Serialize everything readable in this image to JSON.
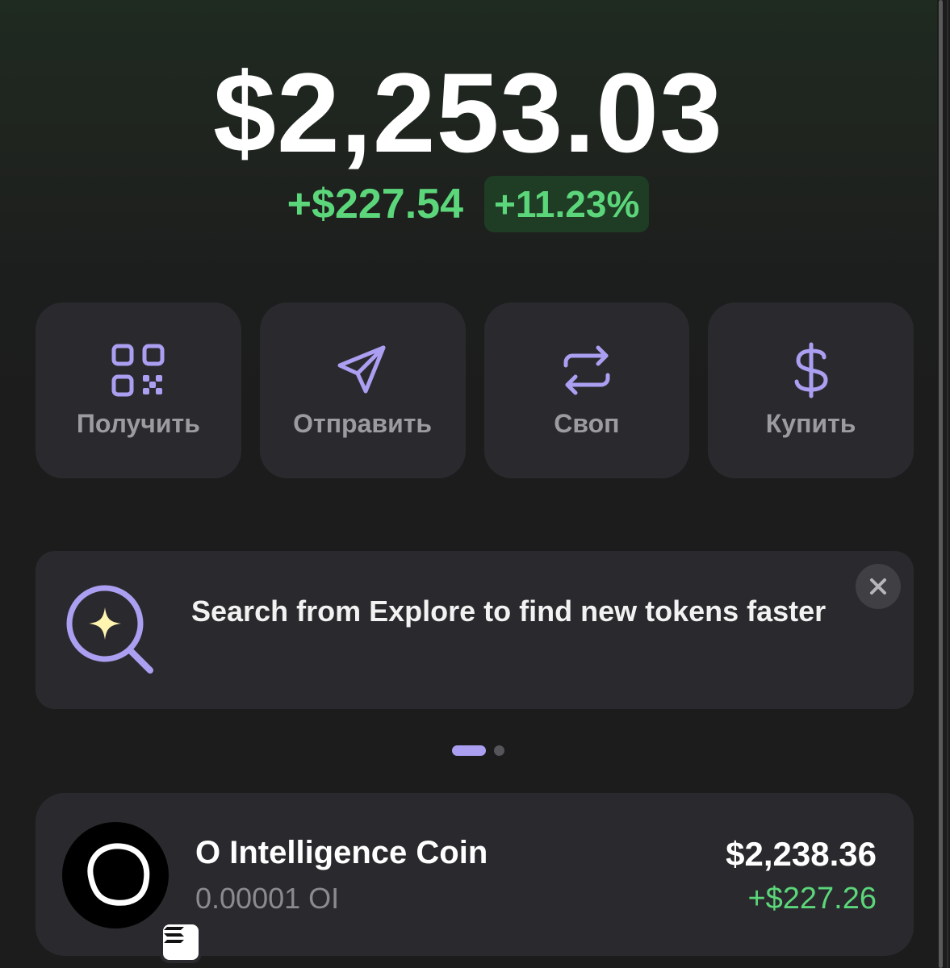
{
  "balance": {
    "total": "$2,253.03",
    "change_amount": "+$227.54",
    "change_percent": "+11.23%"
  },
  "actions": [
    {
      "label": "Получить",
      "icon": "qr-code-icon"
    },
    {
      "label": "Отправить",
      "icon": "send-icon"
    },
    {
      "label": "Своп",
      "icon": "swap-icon"
    },
    {
      "label": "Купить",
      "icon": "dollar-icon"
    }
  ],
  "banner": {
    "text": "Search from Explore to find new tokens faster",
    "icon": "search-sparkle-icon"
  },
  "carousel": {
    "total_pages": 2,
    "active_page": 1
  },
  "tokens": [
    {
      "name": "O Intelligence Coin",
      "amount": "0.00001 OI",
      "value": "$2,238.36",
      "change": "+$227.26",
      "chain_icon": "solana-icon"
    }
  ],
  "colors": {
    "accent": "#ab9ff2",
    "positive": "#5cd67a",
    "card": "#2a2a2e",
    "background": "#1c1c1c"
  }
}
